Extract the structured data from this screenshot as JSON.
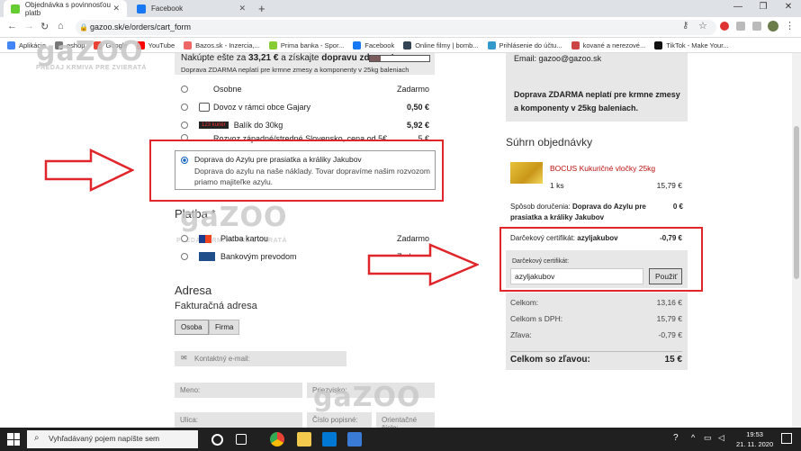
{
  "browser": {
    "tabs": [
      {
        "title": "Objednávka s povinnosťou platb"
      },
      {
        "title": "Facebook"
      }
    ],
    "url": "gazoo.sk/e/orders/cart_form",
    "bookmarks": [
      "Aplikácie",
      "eshop",
      "Google",
      "YouTube",
      "Bazos.sk - Inzercia,...",
      "Prima banka - Spor...",
      "Facebook",
      "Online filmy | bomb...",
      "Prihlásenie do účtu...",
      "kované a nerezové...",
      "TikTok - Make Your..."
    ]
  },
  "logo": {
    "text": "gaZOO",
    "sub": "PREDAJ KRMIVA PRE ZVIERATÁ"
  },
  "promo": {
    "prefix": "Nakúpte ešte za ",
    "amount": "33,21 €",
    "middle": " a získajte ",
    "bold": "dopravu zdarma!",
    "note": "Doprava ZDARMA neplatí pre krmne zmesy a komponenty v 25kg baleniach"
  },
  "shipping": [
    {
      "label": "Osobne",
      "price": "Zadarmo"
    },
    {
      "label": "Dovoz v rámci obce Gajary",
      "price": "0,50 €"
    },
    {
      "label": "Balík do 30kg",
      "price": "5,92 €"
    },
    {
      "label": "Rozvoz západné/stredné Slovensko, cena od 5€",
      "price": "5 €"
    }
  ],
  "selected_shipping": {
    "label": "Doprava do Azylu pre prasiatka a králiky Jakubov",
    "desc": "Doprava do azylu na naše náklady. Tovar dopravíme našim rozvozom priamo majiteľke azylu."
  },
  "courier_logo": "123 kuriér",
  "payment": {
    "title": "Platba *",
    "options": [
      {
        "label": "Platba kartou",
        "price": "Zadarmo"
      },
      {
        "label": "Bankovým prevodom",
        "price": "Zadarmo"
      }
    ]
  },
  "address": {
    "title": "Adresa",
    "billing": "Fakturačná adresa",
    "tabs": [
      "Osoba",
      "Firma"
    ],
    "email_placeholder": "Kontaktný e-mail:",
    "name_placeholder": "Meno:",
    "surname_placeholder": "Priezvisko:",
    "street_placeholder": "Ulica:",
    "house_placeholder": "Číslo popisné:",
    "orient_placeholder": "Orientačné číslo:"
  },
  "contact": {
    "email": "Email: gazoo@gazoo.sk",
    "note": "Doprava ZDARMA neplatí pre krmne zmesy a komponenty v 25kg baleniach."
  },
  "summary": {
    "title": "Súhrn objednávky",
    "product": "BOCUS Kukuričné vločky 25kg",
    "qty": "1 ks",
    "product_price": "15,79 €",
    "delivery_label": "Spôsob doručenia: ",
    "delivery_value": "Doprava do Azylu pre prasiatka a králiky Jakubov",
    "delivery_price": "0 €",
    "cert_label": "Darčekový certifikát: ",
    "cert_value": "azyljakubov",
    "cert_price": "-0,79 €",
    "cert_input_label": "Darčekový certifikát:",
    "cert_input_value": "azyljakubov",
    "apply": "Použiť",
    "totals": [
      {
        "label": "Celkom:",
        "value": "13,16 €"
      },
      {
        "label": "Celkom s DPH:",
        "value": "15,79 €"
      },
      {
        "label": "Zľava:",
        "value": "-0,79 €"
      }
    ],
    "final_label": "Celkom so zľavou:",
    "final_value": "15 €"
  },
  "taskbar": {
    "search": "Vyhľadávaný pojem napíšte sem",
    "time": "19:53",
    "date": "21. 11. 2020"
  },
  "colors": {
    "highlight": "#e0252b",
    "selected_radio": "#1565c0"
  }
}
